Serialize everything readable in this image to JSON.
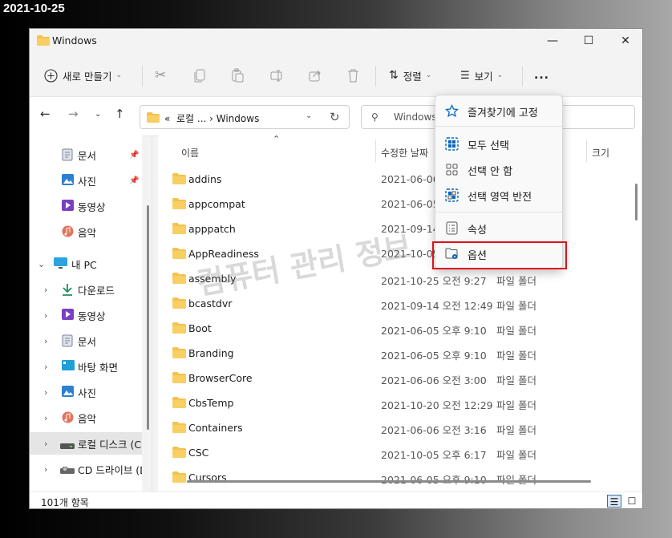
{
  "date_stamp": "2021-10-25",
  "window": {
    "title": "Windows"
  },
  "toolbar": {
    "new_label": "새로 만들기",
    "sort_label": "정렬",
    "view_label": "보기",
    "more_label": "..."
  },
  "address": {
    "prefix": "«",
    "crumbs": "로컬 ...  ›  Windows",
    "search_placeholder": "Windows"
  },
  "sidebar": {
    "items": [
      {
        "label": "문서",
        "icon": "document-icon",
        "pinned": true
      },
      {
        "label": "사진",
        "icon": "pictures-icon",
        "pinned": true
      },
      {
        "label": "동영상",
        "icon": "video-icon"
      },
      {
        "label": "음악",
        "icon": "music-icon"
      },
      {
        "label": "내 PC",
        "icon": "pc-icon"
      },
      {
        "label": "다운로드",
        "icon": "download-icon"
      },
      {
        "label": "동영상",
        "icon": "video-icon"
      },
      {
        "label": "문서",
        "icon": "document-icon"
      },
      {
        "label": "바탕 화면",
        "icon": "desktop-icon"
      },
      {
        "label": "사진",
        "icon": "pictures-icon"
      },
      {
        "label": "음악",
        "icon": "music-icon"
      },
      {
        "label": "로컬 디스크 (C",
        "icon": "drive-icon",
        "selected": true
      },
      {
        "label": "CD 드라이브 (D",
        "icon": "cd-drive-icon"
      }
    ]
  },
  "columns": {
    "name": "이름",
    "date": "수정한 날짜",
    "size": "크기"
  },
  "files": [
    {
      "name": "addins",
      "date": "2021-06-06",
      "type": ""
    },
    {
      "name": "appcompat",
      "date": "2021-06-05",
      "type": ""
    },
    {
      "name": "apppatch",
      "date": "2021-09-14",
      "type": ""
    },
    {
      "name": "AppReadiness",
      "date": "2021-10-05",
      "type": ""
    },
    {
      "name": "assembly",
      "date": "2021-10-25 오전 9:27",
      "type": "파일 폴더"
    },
    {
      "name": "bcastdvr",
      "date": "2021-09-14 오전 12:49",
      "type": "파일 폴더"
    },
    {
      "name": "Boot",
      "date": "2021-06-05 오후 9:10",
      "type": "파일 폴더"
    },
    {
      "name": "Branding",
      "date": "2021-06-05 오후 9:10",
      "type": "파일 폴더"
    },
    {
      "name": "BrowserCore",
      "date": "2021-06-06 오전 3:00",
      "type": "파일 폴더"
    },
    {
      "name": "CbsTemp",
      "date": "2021-10-20 오전 12:29",
      "type": "파일 폴더"
    },
    {
      "name": "Containers",
      "date": "2021-06-06 오전 3:16",
      "type": "파일 폴더"
    },
    {
      "name": "CSC",
      "date": "2021-10-05 오후 6:17",
      "type": "파일 폴더"
    },
    {
      "name": "Cursors",
      "date": "2021-06-05 오후 9:10",
      "type": "파일 폴더"
    }
  ],
  "status": {
    "count": "101개 항목"
  },
  "context_menu": {
    "items": [
      {
        "label": "즐겨찾기에 고정",
        "icon": "star-icon"
      },
      {
        "label": "모두 선택",
        "icon": "select-all-icon"
      },
      {
        "label": "선택 안 함",
        "icon": "select-none-icon"
      },
      {
        "label": "선택 영역 반전",
        "icon": "invert-selection-icon"
      },
      {
        "label": "속성",
        "icon": "properties-icon"
      },
      {
        "label": "옵션",
        "icon": "options-icon",
        "highlighted": true
      }
    ]
  },
  "watermark": "컴퓨터 관리 정보",
  "colors": {
    "folder": "#f4c24f",
    "accent": "#0067c0",
    "highlight": "#d9141b"
  }
}
